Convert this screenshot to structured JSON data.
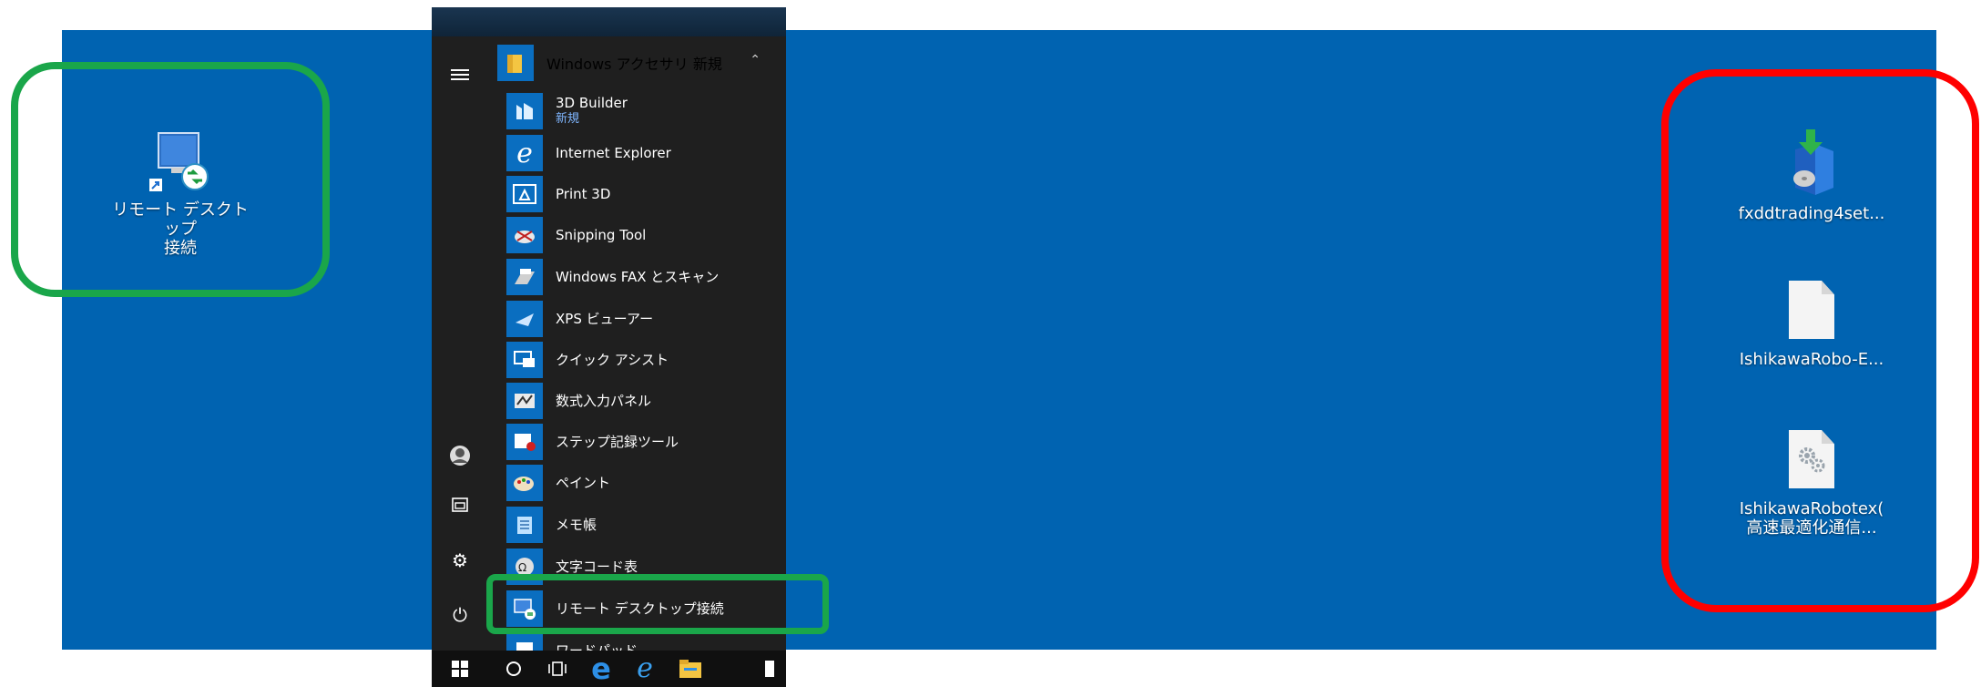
{
  "desktop_left": {
    "icon_label": "リモート デスクトップ\n接続",
    "icon_name": "remote-desktop-icon"
  },
  "start_menu": {
    "folder": {
      "title": "Windows アクセサリ",
      "badge": "新規"
    },
    "items": [
      {
        "label": "3D Builder",
        "badge": "新規",
        "icon": "3d-builder-icon"
      },
      {
        "label": "Internet Explorer",
        "badge": "",
        "icon": "internet-explorer-icon"
      },
      {
        "label": "Print 3D",
        "badge": "",
        "icon": "print-3d-icon"
      },
      {
        "label": "Snipping Tool",
        "badge": "",
        "icon": "snipping-tool-icon"
      },
      {
        "label": "Windows FAX とスキャン",
        "badge": "",
        "icon": "fax-scan-icon"
      },
      {
        "label": "XPS ビューアー",
        "badge": "",
        "icon": "xps-viewer-icon"
      },
      {
        "label": "クイック アシスト",
        "badge": "",
        "icon": "quick-assist-icon"
      },
      {
        "label": "数式入力パネル",
        "badge": "",
        "icon": "math-input-icon"
      },
      {
        "label": "ステップ記録ツール",
        "badge": "",
        "icon": "steps-recorder-icon"
      },
      {
        "label": "ペイント",
        "badge": "",
        "icon": "paint-icon"
      },
      {
        "label": "メモ帳",
        "badge": "",
        "icon": "notepad-icon"
      },
      {
        "label": "文字コード表",
        "badge": "",
        "icon": "character-map-icon"
      },
      {
        "label": "リモート デスクトップ接続",
        "badge": "",
        "icon": "remote-desktop-icon"
      },
      {
        "label": "ワードパッド",
        "badge": "",
        "icon": "wordpad-icon"
      }
    ]
  },
  "desktop_right": {
    "icons": [
      {
        "label": "fxddtrading4set...",
        "icon": "installer-icon"
      },
      {
        "label": "IshikawaRobo-E...",
        "icon": "file-icon"
      },
      {
        "label": "IshikawaRobotex(\n高速最適化通信...",
        "icon": "settings-file-icon"
      }
    ]
  },
  "colors": {
    "desktop_blue": "#0063b1",
    "highlight_green": "#1aa64a",
    "highlight_red": "#ff0000"
  }
}
